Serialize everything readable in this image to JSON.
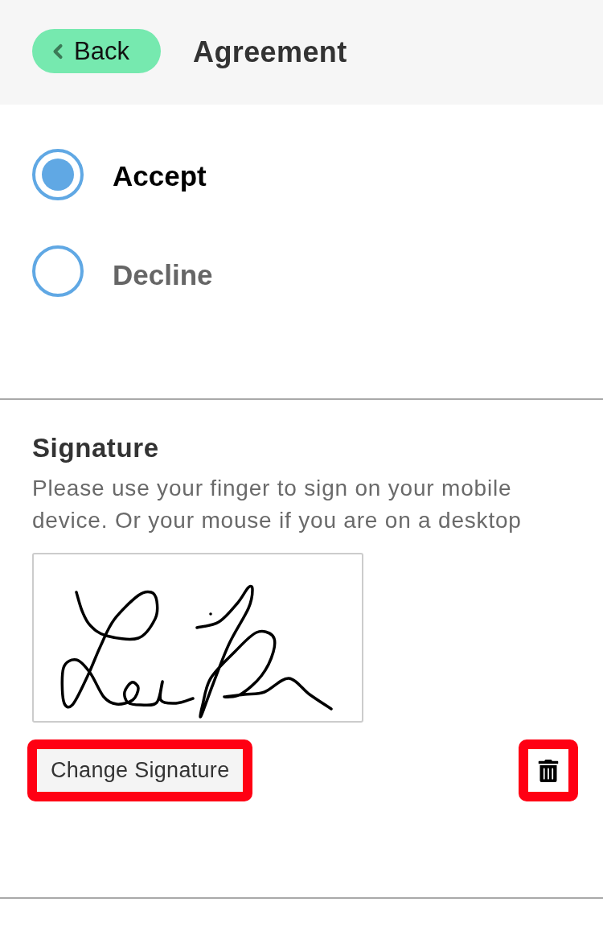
{
  "header": {
    "back_button": {
      "label": "Back"
    },
    "title": "Agreement"
  },
  "options": [
    {
      "label": "Accept",
      "selected": true
    },
    {
      "label": "Decline",
      "selected": false
    }
  ],
  "signature": {
    "title": "Signature",
    "instructions": "Please use your finger to sign on your mobile device. Or your mouse if you are on a desktop",
    "change_button": {
      "label": "Change Signature",
      "highlighted": true
    },
    "delete_button": {
      "highlighted": true
    }
  }
}
